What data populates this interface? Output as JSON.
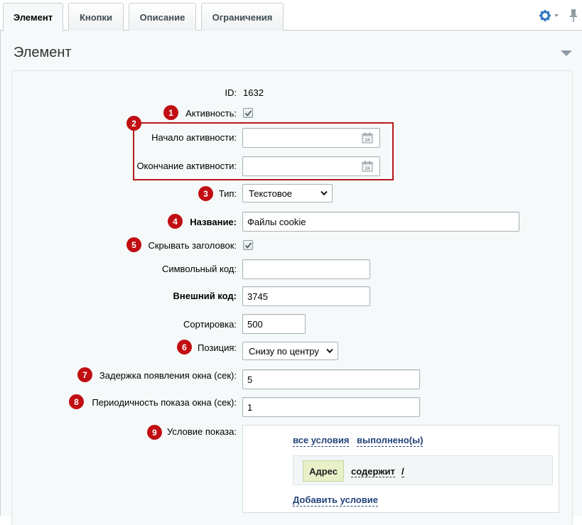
{
  "tabs": [
    {
      "label": "Элемент",
      "active": true
    },
    {
      "label": "Кнопки",
      "active": false
    },
    {
      "label": "Описание",
      "active": false
    },
    {
      "label": "Ограничения",
      "active": false
    }
  ],
  "toolbar": {
    "settings_icon": "gear-icon",
    "pin_icon": "pin-icon"
  },
  "section": {
    "title": "Элемент"
  },
  "form": {
    "id": {
      "label": "ID:",
      "value": "1632"
    },
    "active": {
      "label": "Активность:",
      "checked": true
    },
    "active_from": {
      "label": "Начало активности:",
      "value": ""
    },
    "active_to": {
      "label": "Окончание активности:",
      "value": ""
    },
    "type": {
      "label": "Тип:",
      "value": "Текстовое"
    },
    "name": {
      "label": "Название:",
      "value": "Файлы cookie"
    },
    "hide_title": {
      "label": "Скрывать заголовок:",
      "checked": true
    },
    "code": {
      "label": "Символьный код:",
      "value": ""
    },
    "external_code": {
      "label": "Внешний код:",
      "value": "3745"
    },
    "sort": {
      "label": "Сортировка:",
      "value": "500"
    },
    "position": {
      "label": "Позиция:",
      "value": "Снизу по центру"
    },
    "delay": {
      "label": "Задержка появления окна (сек):",
      "value": "5"
    },
    "period": {
      "label": "Периодичность показа окна (сек):",
      "value": "1"
    },
    "condition": {
      "label": "Условие показа:",
      "scope": "все условия",
      "state": "выполнено(ы)",
      "rule": {
        "field": "Адрес",
        "operator": "содержит",
        "value": "/"
      },
      "add_label": "Добавить условие"
    }
  },
  "badges": [
    "1",
    "2",
    "3",
    "4",
    "5",
    "6",
    "7",
    "8",
    "9"
  ],
  "colors": {
    "badge": "#c00e12",
    "link": "#22437a",
    "panel_bg": "#f5f9f9"
  }
}
